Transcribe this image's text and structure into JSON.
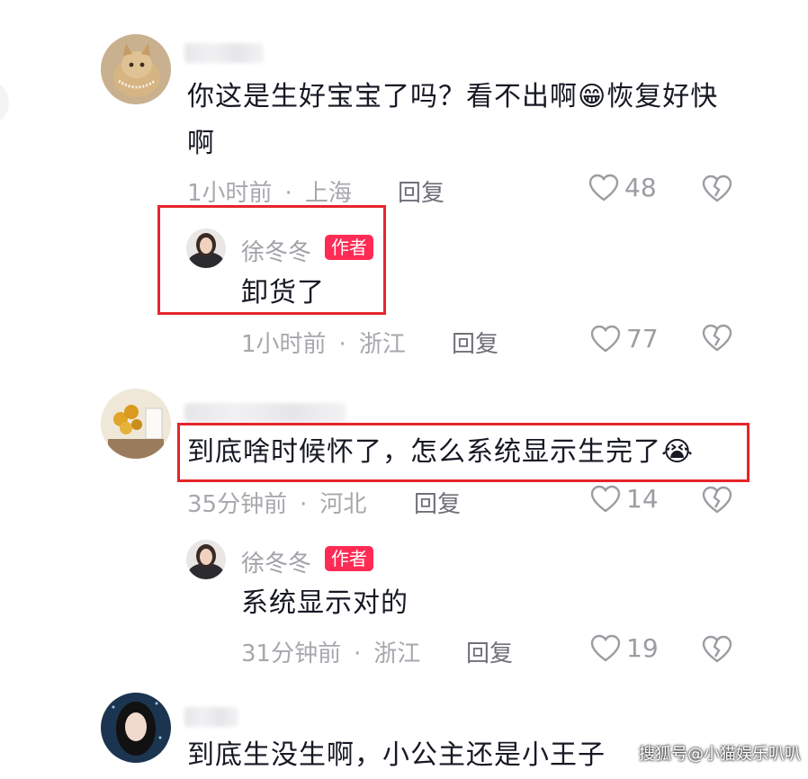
{
  "comments": [
    {
      "text": "你这是生好宝宝了吗？看不出啊😁恢复好快啊",
      "time": "1小时前",
      "location": "上海",
      "reply_label": "回复",
      "likes": "48",
      "reply": {
        "author": "徐冬冬",
        "badge": "作者",
        "text": "卸货了",
        "time": "1小时前",
        "location": "浙江",
        "reply_label": "回复",
        "likes": "77"
      }
    },
    {
      "text": "到底啥时候怀了，怎么系统显示生完了😭",
      "time": "35分钟前",
      "location": "河北",
      "reply_label": "回复",
      "likes": "14",
      "reply": {
        "author": "徐冬冬",
        "badge": "作者",
        "text": "系统显示对的",
        "time": "31分钟前",
        "location": "浙江",
        "reply_label": "回复",
        "likes": "19"
      }
    },
    {
      "text": "到底生没生啊，小公主还是小王子"
    }
  ],
  "watermark": "搜狐号@小猫娱乐叭叭",
  "colors": {
    "highlight_box": "#e5252a",
    "author_badge": "#fe2c55"
  },
  "icons": [
    "heart-outline-icon",
    "broken-heart-icon"
  ]
}
